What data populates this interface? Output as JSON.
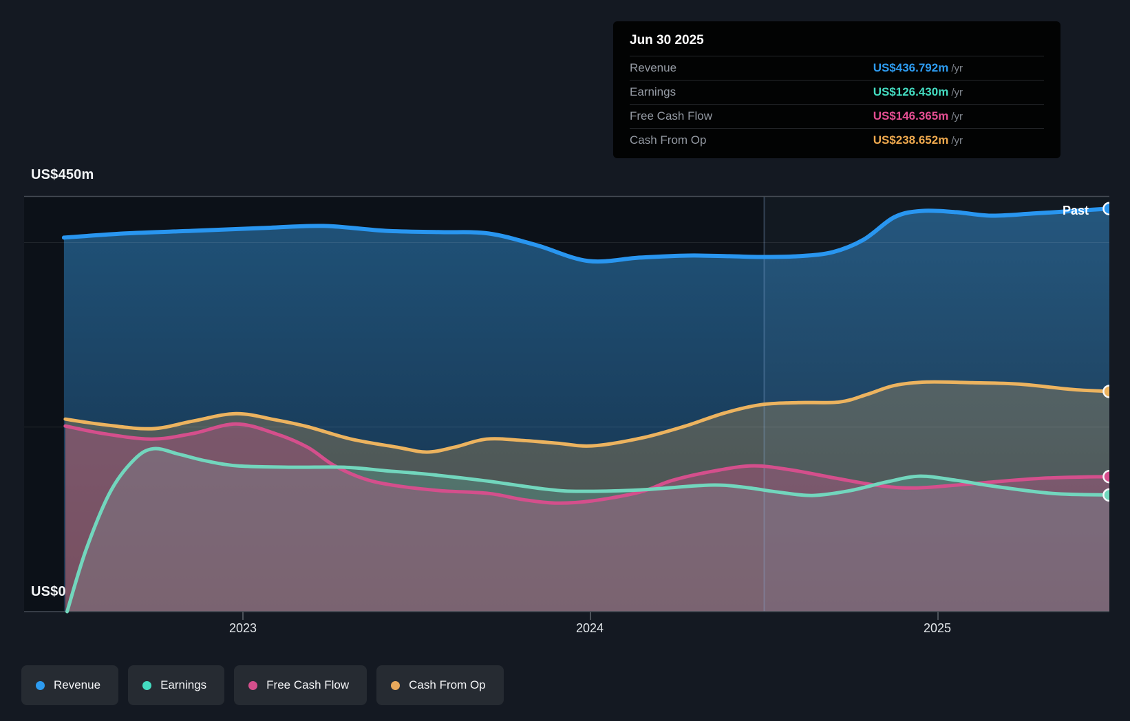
{
  "tooltip": {
    "date": "Jun 30 2025",
    "rows": [
      {
        "label": "Revenue",
        "value": "US$436.792m",
        "suffix": "/yr",
        "color": "#2d9bf0"
      },
      {
        "label": "Earnings",
        "value": "US$126.430m",
        "suffix": "/yr",
        "color": "#44dcc1"
      },
      {
        "label": "Free Cash Flow",
        "value": "US$146.365m",
        "suffix": "/yr",
        "color": "#e44e92"
      },
      {
        "label": "Cash From Op",
        "value": "US$238.652m",
        "suffix": "/yr",
        "color": "#efa94e"
      }
    ]
  },
  "axis": {
    "y_top": "US$450m",
    "y_zero": "US$0",
    "x_ticks": [
      "2023",
      "2024",
      "2025"
    ]
  },
  "past_label": "Past",
  "legend": [
    {
      "label": "Revenue",
      "color": "#2d9bf0"
    },
    {
      "label": "Earnings",
      "color": "#44dcc1"
    },
    {
      "label": "Free Cash Flow",
      "color": "#d44f8c"
    },
    {
      "label": "Cash From Op",
      "color": "#e8a95c"
    }
  ],
  "chart_data": {
    "type": "area",
    "title": "Past earnings and revenue history",
    "x_unit": "decimal_year",
    "y_unit": "US$ millions",
    "xlim": [
      2022.485,
      2025.493
    ],
    "ylim": [
      0,
      450
    ],
    "x_tick_values": [
      2023,
      2024,
      2025
    ],
    "gridlines_m": [
      450,
      400,
      200,
      0
    ],
    "divider_x": 2024.5,
    "highlight_region": [
      2024.5,
      2025.493
    ],
    "legend_position": "bottom-left",
    "series": [
      {
        "name": "Revenue",
        "color": "#2996f0",
        "fill": "gradient-blue",
        "line_width": 6,
        "end_value": 436.792,
        "points": [
          [
            2022.485,
            405.3
          ],
          [
            2022.657,
            409.8
          ],
          [
            2022.855,
            412.7
          ],
          [
            2023.053,
            415.7
          ],
          [
            2023.232,
            418.0
          ],
          [
            2023.41,
            412.7
          ],
          [
            2023.568,
            411.3
          ],
          [
            2023.707,
            409.8
          ],
          [
            2023.845,
            397.1
          ],
          [
            2023.994,
            380.0
          ],
          [
            2024.143,
            383.7
          ],
          [
            2024.281,
            385.9
          ],
          [
            2024.4,
            385.2
          ],
          [
            2024.491,
            384.4
          ],
          [
            2024.598,
            385.2
          ],
          [
            2024.697,
            389.6
          ],
          [
            2024.786,
            403.1
          ],
          [
            2024.875,
            427.6
          ],
          [
            2024.954,
            434.3
          ],
          [
            2025.053,
            432.9
          ],
          [
            2025.152,
            429.1
          ],
          [
            2025.271,
            431.4
          ],
          [
            2025.39,
            434.3
          ],
          [
            2025.493,
            436.792
          ]
        ]
      },
      {
        "name": "Cash From Op",
        "color": "#ecb35f",
        "fill": "rgba(235,175,85,0.26)",
        "line_width": 5,
        "end_value": 238.652,
        "points": [
          [
            2022.489,
            208.6
          ],
          [
            2022.598,
            202.7
          ],
          [
            2022.737,
            198.2
          ],
          [
            2022.855,
            206.4
          ],
          [
            2022.98,
            214.6
          ],
          [
            2023.093,
            207.9
          ],
          [
            2023.186,
            200.4
          ],
          [
            2023.311,
            187.0
          ],
          [
            2023.444,
            178.1
          ],
          [
            2023.529,
            172.9
          ],
          [
            2023.608,
            178.1
          ],
          [
            2023.701,
            187.0
          ],
          [
            2023.806,
            185.5
          ],
          [
            2023.905,
            182.5
          ],
          [
            2024.004,
            179.6
          ],
          [
            2024.143,
            187.8
          ],
          [
            2024.267,
            200.4
          ],
          [
            2024.386,
            215.3
          ],
          [
            2024.491,
            224.3
          ],
          [
            2024.598,
            226.5
          ],
          [
            2024.717,
            227.2
          ],
          [
            2024.796,
            235.4
          ],
          [
            2024.875,
            245.1
          ],
          [
            2024.968,
            248.8
          ],
          [
            2025.099,
            248.1
          ],
          [
            2025.232,
            246.6
          ],
          [
            2025.39,
            240.6
          ],
          [
            2025.493,
            238.652
          ]
        ]
      },
      {
        "name": "Earnings",
        "color": "#72d6bd",
        "fill": "rgba(95,215,185,0.22)",
        "line_width": 5,
        "end_value": 126.43,
        "points": [
          [
            2022.494,
            0.0
          ],
          [
            2022.548,
            66.3
          ],
          [
            2022.618,
            129.6
          ],
          [
            2022.687,
            164.7
          ],
          [
            2022.743,
            176.6
          ],
          [
            2022.816,
            170.6
          ],
          [
            2022.895,
            163.2
          ],
          [
            2022.984,
            158.0
          ],
          [
            2023.133,
            156.5
          ],
          [
            2023.291,
            156.5
          ],
          [
            2023.41,
            152.7
          ],
          [
            2023.529,
            149.0
          ],
          [
            2023.687,
            142.3
          ],
          [
            2023.875,
            132.6
          ],
          [
            2023.974,
            130.4
          ],
          [
            2024.143,
            131.9
          ],
          [
            2024.341,
            137.1
          ],
          [
            2024.44,
            134.9
          ],
          [
            2024.539,
            129.6
          ],
          [
            2024.638,
            125.9
          ],
          [
            2024.747,
            131.1
          ],
          [
            2024.855,
            140.8
          ],
          [
            2024.948,
            146.8
          ],
          [
            2025.053,
            142.3
          ],
          [
            2025.166,
            135.6
          ],
          [
            2025.33,
            128.1
          ],
          [
            2025.493,
            126.43
          ]
        ]
      },
      {
        "name": "Free Cash Flow",
        "color": "#d44f8c",
        "fill": "rgba(222,80,145,0.30)",
        "line_width": 5,
        "end_value": 146.365,
        "points": [
          [
            2022.489,
            201.2
          ],
          [
            2022.598,
            193.0
          ],
          [
            2022.737,
            187.0
          ],
          [
            2022.855,
            193.0
          ],
          [
            2022.98,
            203.4
          ],
          [
            2023.093,
            193.0
          ],
          [
            2023.186,
            178.1
          ],
          [
            2023.261,
            158.7
          ],
          [
            2023.35,
            143.8
          ],
          [
            2023.444,
            136.3
          ],
          [
            2023.568,
            131.1
          ],
          [
            2023.707,
            128.1
          ],
          [
            2023.806,
            121.4
          ],
          [
            2023.899,
            117.7
          ],
          [
            2024.004,
            120.0
          ],
          [
            2024.143,
            129.6
          ],
          [
            2024.236,
            142.3
          ],
          [
            2024.36,
            152.7
          ],
          [
            2024.469,
            158.0
          ],
          [
            2024.578,
            153.5
          ],
          [
            2024.717,
            143.8
          ],
          [
            2024.836,
            136.3
          ],
          [
            2024.941,
            134.1
          ],
          [
            2025.099,
            138.6
          ],
          [
            2025.297,
            144.5
          ],
          [
            2025.493,
            146.365
          ]
        ]
      }
    ]
  }
}
